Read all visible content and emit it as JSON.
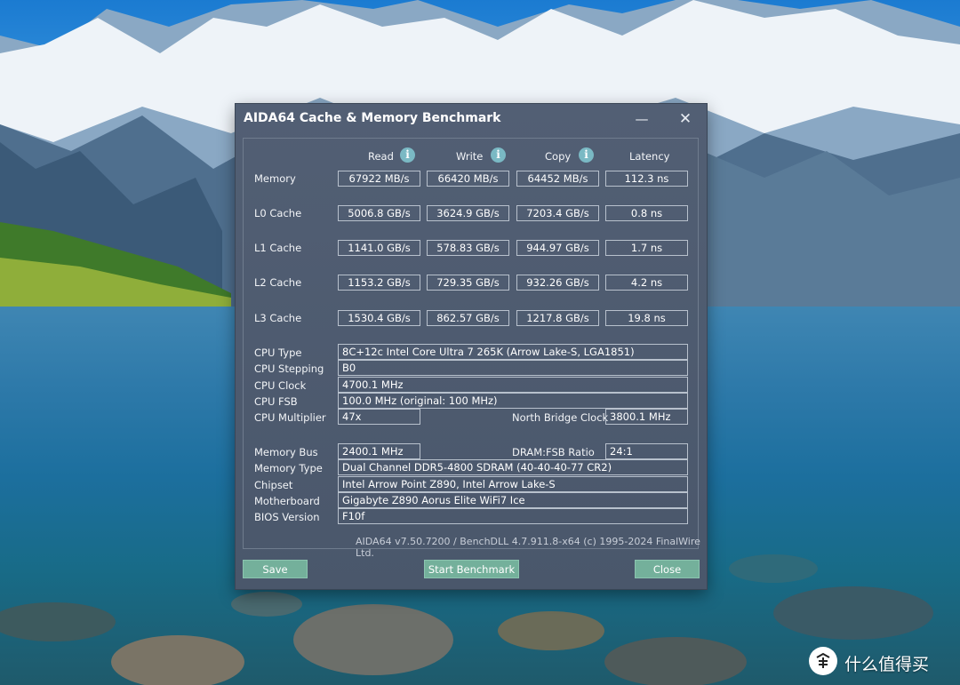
{
  "window": {
    "title": "AIDA64 Cache & Memory Benchmark",
    "minimize_glyph": "—",
    "close_glyph": "✕"
  },
  "columns": {
    "read": "Read",
    "write": "Write",
    "copy": "Copy",
    "latency": "Latency",
    "info_glyph": "i"
  },
  "rows": [
    {
      "label": "Memory",
      "read": "67922 MB/s",
      "write": "66420 MB/s",
      "copy": "64452 MB/s",
      "latency": "112.3 ns"
    },
    {
      "label": "L0 Cache",
      "read": "5006.8 GB/s",
      "write": "3624.9 GB/s",
      "copy": "7203.4 GB/s",
      "latency": "0.8 ns"
    },
    {
      "label": "L1 Cache",
      "read": "1141.0 GB/s",
      "write": "578.83 GB/s",
      "copy": "944.97 GB/s",
      "latency": "1.7 ns"
    },
    {
      "label": "L2 Cache",
      "read": "1153.2 GB/s",
      "write": "729.35 GB/s",
      "copy": "932.26 GB/s",
      "latency": "4.2 ns"
    },
    {
      "label": "L3 Cache",
      "read": "1530.4 GB/s",
      "write": "862.57 GB/s",
      "copy": "1217.8 GB/s",
      "latency": "19.8 ns"
    }
  ],
  "info": {
    "cpu_type_label": "CPU Type",
    "cpu_type": "8C+12c Intel Core Ultra 7 265K  (Arrow Lake-S, LGA1851)",
    "cpu_stepping_label": "CPU Stepping",
    "cpu_stepping": "B0",
    "cpu_clock_label": "CPU Clock",
    "cpu_clock": "4700.1 MHz",
    "cpu_fsb_label": "CPU FSB",
    "cpu_fsb": "100.0 MHz  (original: 100 MHz)",
    "cpu_multiplier_label": "CPU Multiplier",
    "cpu_multiplier": "47x",
    "nb_clock_label": "North Bridge Clock",
    "nb_clock": "3800.1 MHz",
    "memory_bus_label": "Memory Bus",
    "memory_bus": "2400.1 MHz",
    "dram_fsb_label": "DRAM:FSB Ratio",
    "dram_fsb": "24:1",
    "memory_type_label": "Memory Type",
    "memory_type": "Dual Channel DDR5-4800 SDRAM  (40-40-40-77 CR2)",
    "chipset_label": "Chipset",
    "chipset": "Intel Arrow Point Z890, Intel Arrow Lake-S",
    "motherboard_label": "Motherboard",
    "motherboard": "Gigabyte Z890 Aorus Elite WiFi7 Ice",
    "bios_label": "BIOS Version",
    "bios": "F10f"
  },
  "footer": "AIDA64 v7.50.7200 / BenchDLL 4.7.911.8-x64  (c) 1995-2024 FinalWire Ltd.",
  "buttons": {
    "save": "Save",
    "start": "Start Benchmark",
    "close": "Close"
  },
  "watermark": {
    "text": "什么值得买",
    "logo_glyph": "值"
  },
  "colors": {
    "dialog_bg": "#4d5a6e",
    "button_bg": "#74b09b",
    "info_icon": "#7ab9c4",
    "box_border": "#b8c1cd"
  }
}
